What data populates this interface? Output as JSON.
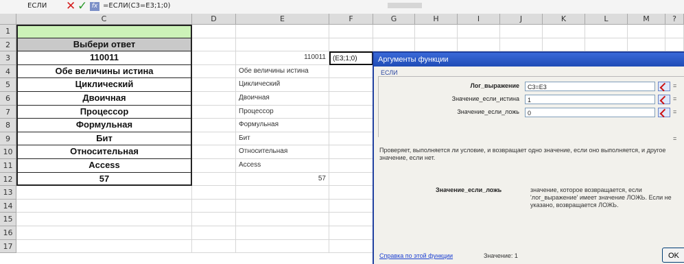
{
  "formula_bar": {
    "name_box": "ЕСЛИ",
    "cancel_glyph": "✕",
    "enter_glyph": "✓",
    "fx_label": "fx",
    "formula": "=ЕСЛИ(C3=E3;1;0)"
  },
  "columns": [
    "C",
    "D",
    "E",
    "F",
    "G",
    "H",
    "I",
    "J",
    "K",
    "L",
    "M",
    "?"
  ],
  "rows": [
    "1",
    "2",
    "3",
    "4",
    "5",
    "6",
    "7",
    "8",
    "9",
    "10",
    "11",
    "12",
    "13",
    "14",
    "15",
    "16",
    "17"
  ],
  "column_c": [
    "",
    "Выбери ответ",
    "110011",
    "Обе величины истина",
    "Циклический",
    "Двоичная",
    "Процессор",
    "Формульная",
    "Бит",
    "Относительная",
    "Access",
    "57"
  ],
  "column_e": [
    "",
    "",
    "110011",
    "Обе величины истина",
    "Циклический",
    "Двоичная",
    "Процессор",
    "Формульная",
    "Бит",
    "Относительная",
    "Access",
    "57"
  ],
  "f3_value": "(E3;1;0)",
  "colors": {
    "header_green": "#ccf2b8",
    "header_gray": "#c9c9c9",
    "dialog_title": "#1f4cb6"
  },
  "dialog": {
    "title": "Аргументы функции",
    "function_name": "ЕСЛИ",
    "args": [
      {
        "label": "Лог_выражение",
        "value": "C3=E3"
      },
      {
        "label": "Значение_если_истина",
        "value": "1"
      },
      {
        "label": "Значение_если_ложь",
        "value": "0"
      }
    ],
    "arg_result_prefix": "=",
    "result_eq": "=",
    "description": "Проверяет, выполняется ли условие, и возвращает одно значение, если оно выполняется, и другое значение, если нет.",
    "arg_help_label": "Значение_если_ложь",
    "arg_help_text": "значение, которое возвращается, если 'лог_выражение' имеет значение ЛОЖЬ. Если не указано, возвращается ЛОЖЬ.",
    "help_link": "Справка по этой функции",
    "value_label": "Значение: 1",
    "ok_label": "OK"
  }
}
